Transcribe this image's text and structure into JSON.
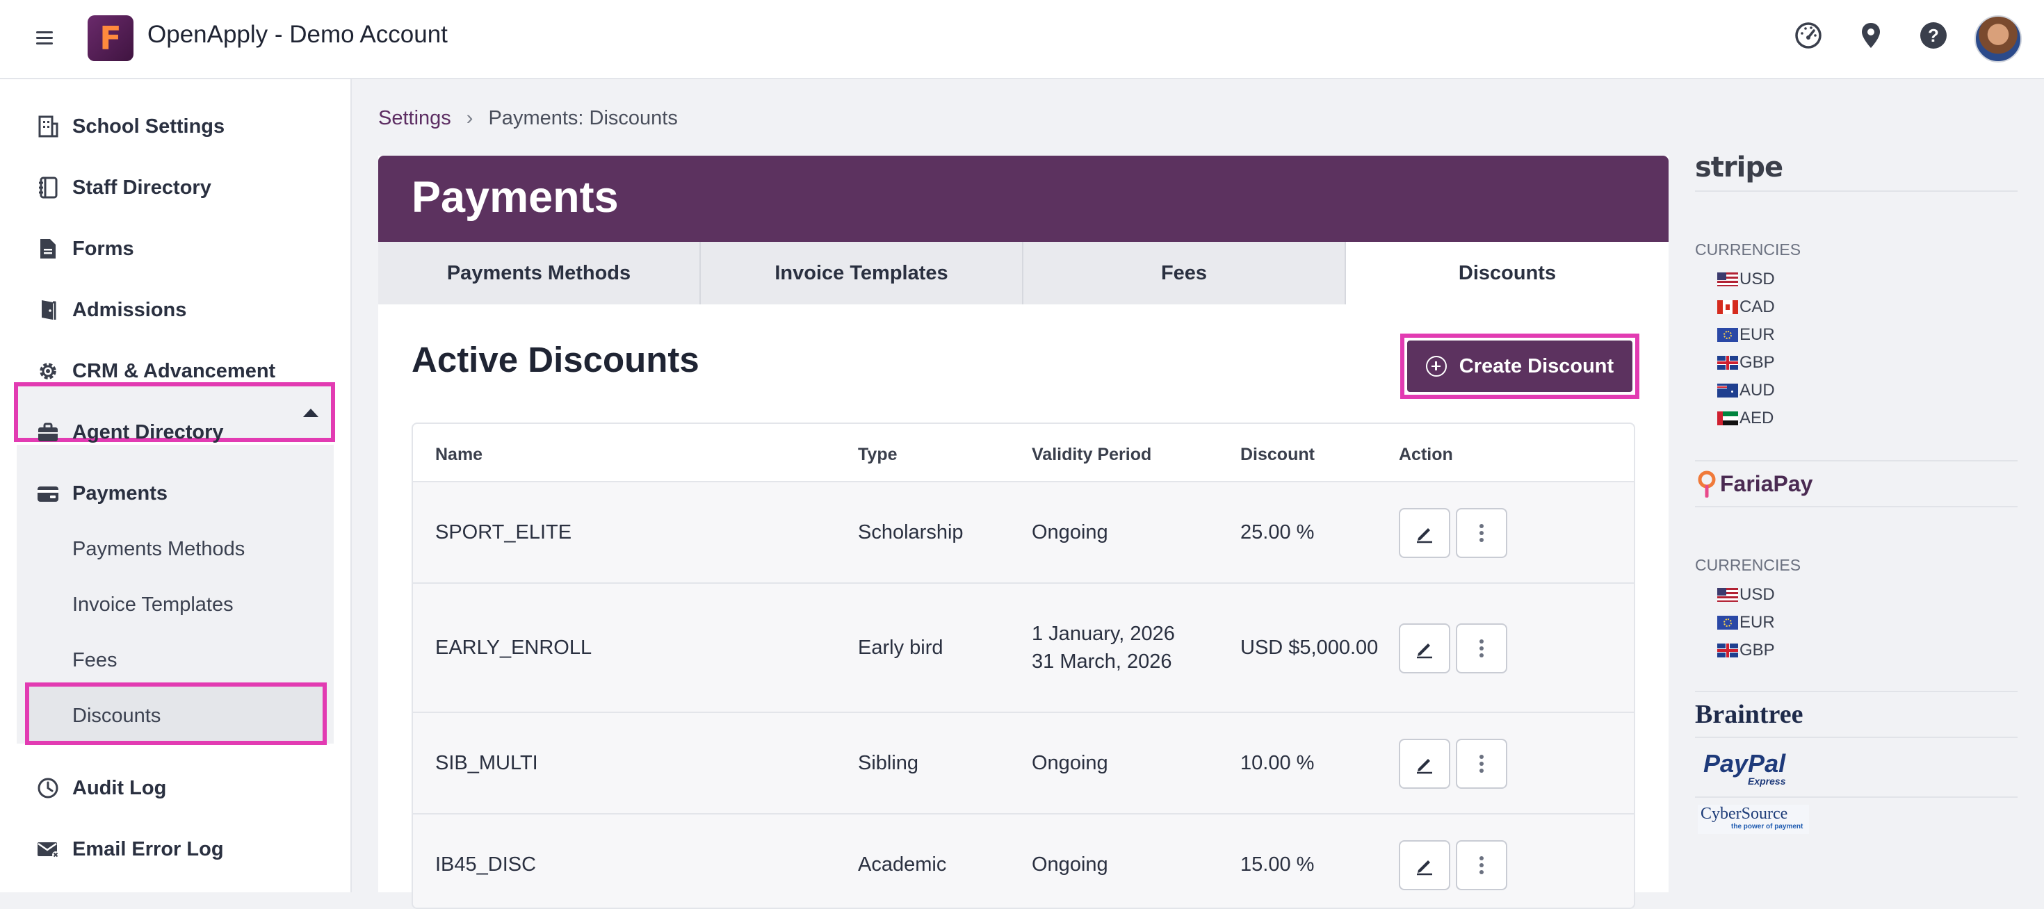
{
  "app": {
    "title": "OpenApply - Demo Account",
    "logo_letter": "F"
  },
  "top_icons": [
    "dashboard-icon",
    "location-pin-icon",
    "help-icon"
  ],
  "sidebar": {
    "items": [
      {
        "label": "School Settings",
        "icon": "building-icon"
      },
      {
        "label": "Staff Directory",
        "icon": "book-icon"
      },
      {
        "label": "Forms",
        "icon": "document-icon"
      },
      {
        "label": "Admissions",
        "icon": "door-icon"
      },
      {
        "label": "CRM & Advancement",
        "icon": "gear-icon"
      },
      {
        "label": "Agent Directory",
        "icon": "briefcase-icon"
      },
      {
        "label": "Payments",
        "icon": "wallet-icon"
      },
      {
        "label": "Audit Log",
        "icon": "clock-icon"
      },
      {
        "label": "Email Error Log",
        "icon": "mail-error-icon"
      }
    ],
    "payments_sub": [
      "Payments Methods",
      "Invoice Templates",
      "Fees",
      "Discounts"
    ]
  },
  "breadcrumb": {
    "parent": "Settings",
    "current": "Payments: Discounts"
  },
  "panel": {
    "title": "Payments",
    "tabs": [
      "Payments Methods",
      "Invoice Templates",
      "Fees",
      "Discounts"
    ],
    "active_tab": "Discounts",
    "section_title": "Active Discounts",
    "create_label": "Create Discount"
  },
  "table": {
    "headers": [
      "Name",
      "Type",
      "Validity Period",
      "Discount",
      "Action"
    ],
    "rows": [
      {
        "name": "SPORT_ELITE",
        "type": "Scholarship",
        "validity": [
          "Ongoing"
        ],
        "discount": "25.00 %"
      },
      {
        "name": "EARLY_ENROLL",
        "type": "Early bird",
        "validity": [
          "1 January, 2026",
          "31 March, 2026"
        ],
        "discount": "USD $5,000.00"
      },
      {
        "name": "SIB_MULTI",
        "type": "Sibling",
        "validity": [
          "Ongoing"
        ],
        "discount": "10.00 %"
      },
      {
        "name": "IB45_DISC",
        "type": "Academic",
        "validity": [
          "Ongoing"
        ],
        "discount": "15.00 %"
      }
    ]
  },
  "gateways": {
    "stripe": {
      "logo": "stripe",
      "currencies_title": "CURRENCIES",
      "currencies": [
        "USD",
        "CAD",
        "EUR",
        "GBP",
        "AUD",
        "AED"
      ]
    },
    "fariapay": {
      "logo": "FariaPay",
      "currencies_title": "CURRENCIES",
      "currencies": [
        "USD",
        "EUR",
        "GBP"
      ]
    },
    "braintree": {
      "logo": "Braintree"
    },
    "paypal": {
      "logo": "PayPal",
      "sub": "Express"
    },
    "cybersource": {
      "logo": "CyberSource",
      "tagline": "the power of payment"
    }
  },
  "colors": {
    "brand": "#5c325f",
    "highlight": "#e23bb2"
  }
}
